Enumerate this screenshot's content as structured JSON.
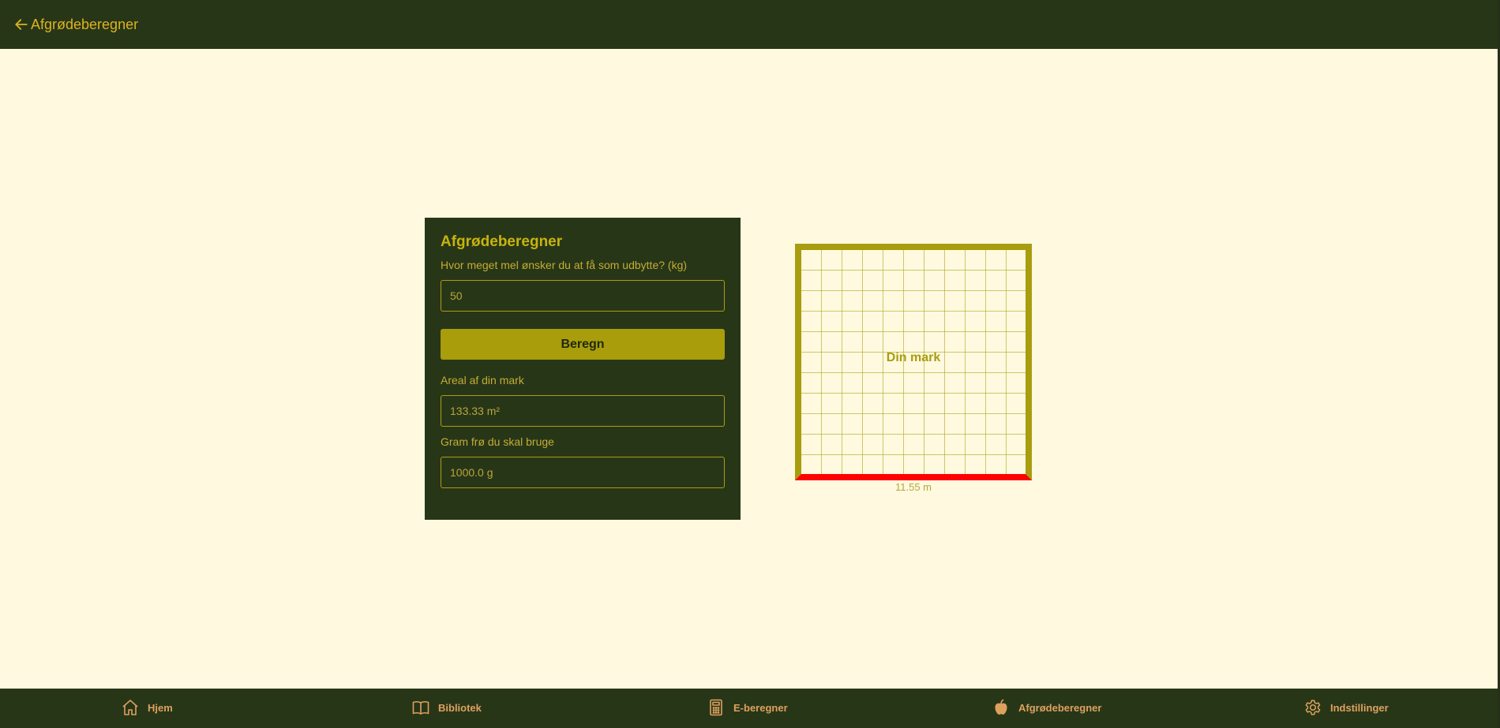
{
  "header": {
    "title": "Afgrødeberegner"
  },
  "card": {
    "title": "Afgrødeberegner",
    "yield_label": "Hvor meget mel ønsker du at få som udbytte? (kg)",
    "yield_value": "50",
    "calc_button": "Beregn",
    "area_label": "Areal af din mark",
    "area_value": "133.33 m²",
    "seed_label": "Gram frø du skal bruge",
    "seed_value": "1000.0 g"
  },
  "field_visual": {
    "label": "Din mark",
    "side_length": "11.55 m"
  },
  "bottom_nav": [
    {
      "label": "Hjem",
      "icon": "home-icon"
    },
    {
      "label": "Bibliotek",
      "icon": "book-icon"
    },
    {
      "label": "E-beregner",
      "icon": "calculator-icon"
    },
    {
      "label": "Afgrødeberegner",
      "icon": "apple-icon"
    },
    {
      "label": "Indstillinger",
      "icon": "gear-icon"
    }
  ],
  "colors": {
    "bar_background": "#283618",
    "page_background": "#fef9df",
    "accent": "#a99d0b",
    "nav_text": "#dda15e",
    "highlight_edge": "#ff0000"
  }
}
